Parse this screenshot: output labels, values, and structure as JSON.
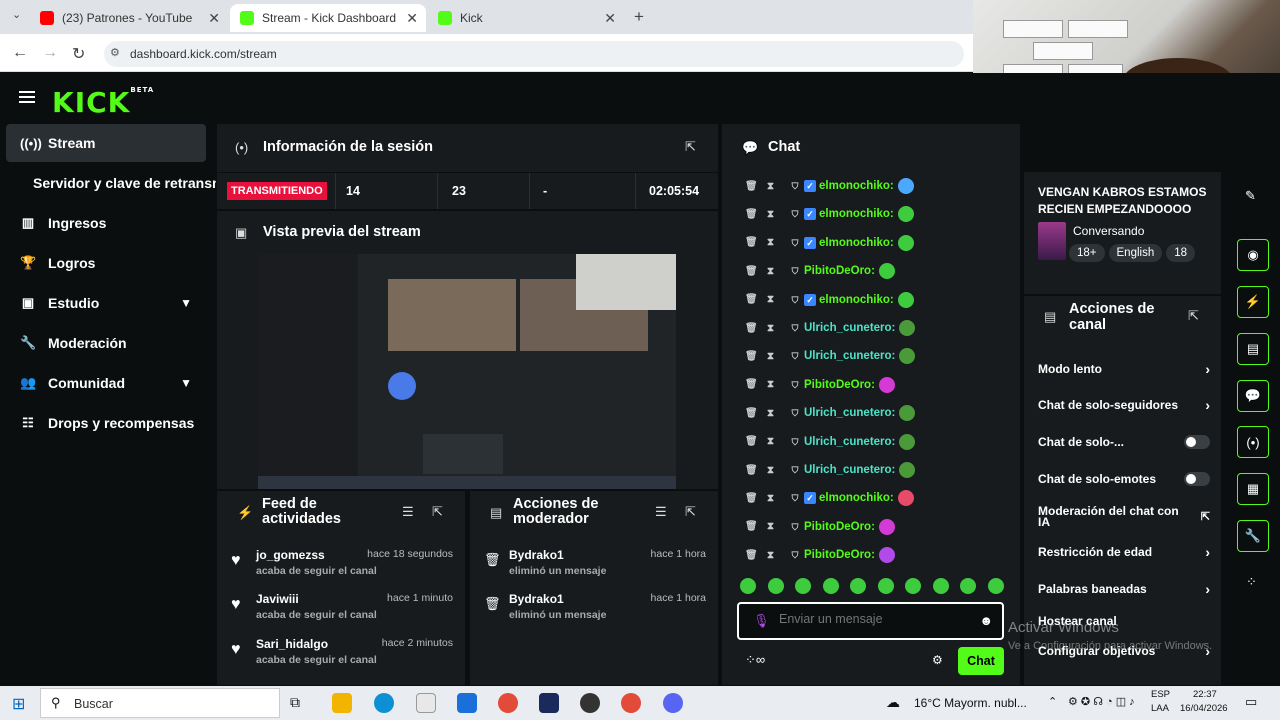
{
  "browser": {
    "tabs": [
      {
        "title": "(23) Patrones - YouTube",
        "color": "#ff0000"
      },
      {
        "title": "Stream - Kick Dashboard",
        "color": "#53fc18"
      },
      {
        "title": "Kick",
        "color": "#53fc18"
      }
    ],
    "url": "dashboard.kick.com/stream"
  },
  "brand": {
    "logo": "KICK",
    "beta": "BETA",
    "accent": "#53fc18"
  },
  "sidebar": {
    "items": [
      {
        "label": "Stream",
        "icon": "broadcast-icon"
      },
      {
        "label": "Servidor y clave de retransm",
        "icon": ""
      },
      {
        "label": "Ingresos",
        "icon": "chart-icon"
      },
      {
        "label": "Logros",
        "icon": "trophy-icon"
      },
      {
        "label": "Estudio",
        "icon": "studio-icon"
      },
      {
        "label": "Moderación",
        "icon": "wrench-icon"
      },
      {
        "label": "Comunidad",
        "icon": "community-icon"
      },
      {
        "label": "Drops y recompensas",
        "icon": "gift-icon"
      }
    ]
  },
  "session": {
    "title": "Información de la sesión",
    "status": "TRANSMITIENDO",
    "viewers": "14",
    "followers": "23",
    "subs": "-",
    "uptime": "02:05:54"
  },
  "preview": {
    "title": "Vista previa del stream"
  },
  "feed": {
    "title": "Feed de actividades",
    "items": [
      {
        "name": "jo_gomezss",
        "text": "acaba de seguir el canal",
        "time": "hace 18 segundos"
      },
      {
        "name": "Javiwiii",
        "text": "acaba de seguir el canal",
        "time": "hace 1 minuto"
      },
      {
        "name": "Sari_hidalgo",
        "text": "acaba de seguir el canal",
        "time": "hace 2 minutos"
      }
    ]
  },
  "modactions": {
    "title": "Acciones de moderador",
    "items": [
      {
        "name": "Bydrako1",
        "text": "eliminó un mensaje",
        "time": "hace 1 hora"
      },
      {
        "name": "Bydrako1",
        "text": "eliminó un mensaje",
        "time": "hace 1 hora"
      }
    ]
  },
  "chat": {
    "title": "Chat",
    "messages": [
      {
        "user": "elmonochiko:",
        "color": "#53fc18",
        "verified": true,
        "emote": "#4aa8ff"
      },
      {
        "user": "elmonochiko:",
        "color": "#53fc18",
        "verified": true,
        "emote": "#3ecb3e"
      },
      {
        "user": "elmonochiko:",
        "color": "#53fc18",
        "verified": true,
        "emote": "#3ecb3e"
      },
      {
        "user": "PibitoDeOro:",
        "color": "#53fc18",
        "verified": false,
        "emote": "#3ecb3e"
      },
      {
        "user": "elmonochiko:",
        "color": "#53fc18",
        "verified": true,
        "emote": "#3ecb3e"
      },
      {
        "user": "Ulrich_cunetero:",
        "color": "#4de3c8",
        "verified": false,
        "emote": "#4a9a3a"
      },
      {
        "user": "Ulrich_cunetero:",
        "color": "#4de3c8",
        "verified": false,
        "emote": "#4a9a3a"
      },
      {
        "user": "PibitoDeOro:",
        "color": "#53fc18",
        "verified": false,
        "emote": "#d43bd4"
      },
      {
        "user": "Ulrich_cunetero:",
        "color": "#4de3c8",
        "verified": false,
        "emote": "#4a9a3a"
      },
      {
        "user": "Ulrich_cunetero:",
        "color": "#4de3c8",
        "verified": false,
        "emote": "#4a9a3a"
      },
      {
        "user": "Ulrich_cunetero:",
        "color": "#4de3c8",
        "verified": false,
        "emote": "#4a9a3a"
      },
      {
        "user": "elmonochiko:",
        "color": "#53fc18",
        "verified": true,
        "emote": "#e84a6a"
      },
      {
        "user": "PibitoDeOro:",
        "color": "#53fc18",
        "verified": false,
        "emote": "#d43bd4"
      },
      {
        "user": "PibitoDeOro:",
        "color": "#53fc18",
        "verified": false,
        "emote": "#b04ae8"
      }
    ],
    "placeholder": "Enviar un mensaje",
    "send_label": "Chat"
  },
  "streaminfo": {
    "title": "VENGAN KABROS ESTAMOS RECIEN EMPEZANDOOOO",
    "category": "Conversando",
    "tags": [
      "18+",
      "English",
      "18"
    ]
  },
  "channelactions": {
    "title": "Acciones de canal",
    "items": [
      {
        "label": "Modo lento",
        "control": "arrow"
      },
      {
        "label": "Chat de solo-seguidores",
        "control": "arrow"
      },
      {
        "label": "Chat de solo-...",
        "control": "toggle"
      },
      {
        "label": "Chat de solo-emotes",
        "control": "toggle"
      },
      {
        "label": "Moderación del chat con IA",
        "control": "external"
      },
      {
        "label": "Restricción de edad",
        "control": "arrow"
      },
      {
        "label": "Palabras baneadas",
        "control": "arrow"
      },
      {
        "label": "Hostear canal",
        "control": "none"
      },
      {
        "label": "Configurar objetivos",
        "control": "arrow"
      }
    ]
  },
  "watermark": {
    "line1": "Activar Windows",
    "line2": "Ve a Configuración para activar Windows."
  },
  "taskbar": {
    "search": "Buscar",
    "weather": "16°C  Mayorm. nubl...",
    "lang1": "ESP",
    "lang2": "LAA",
    "time": "22:37",
    "date": "16/04/2026"
  }
}
